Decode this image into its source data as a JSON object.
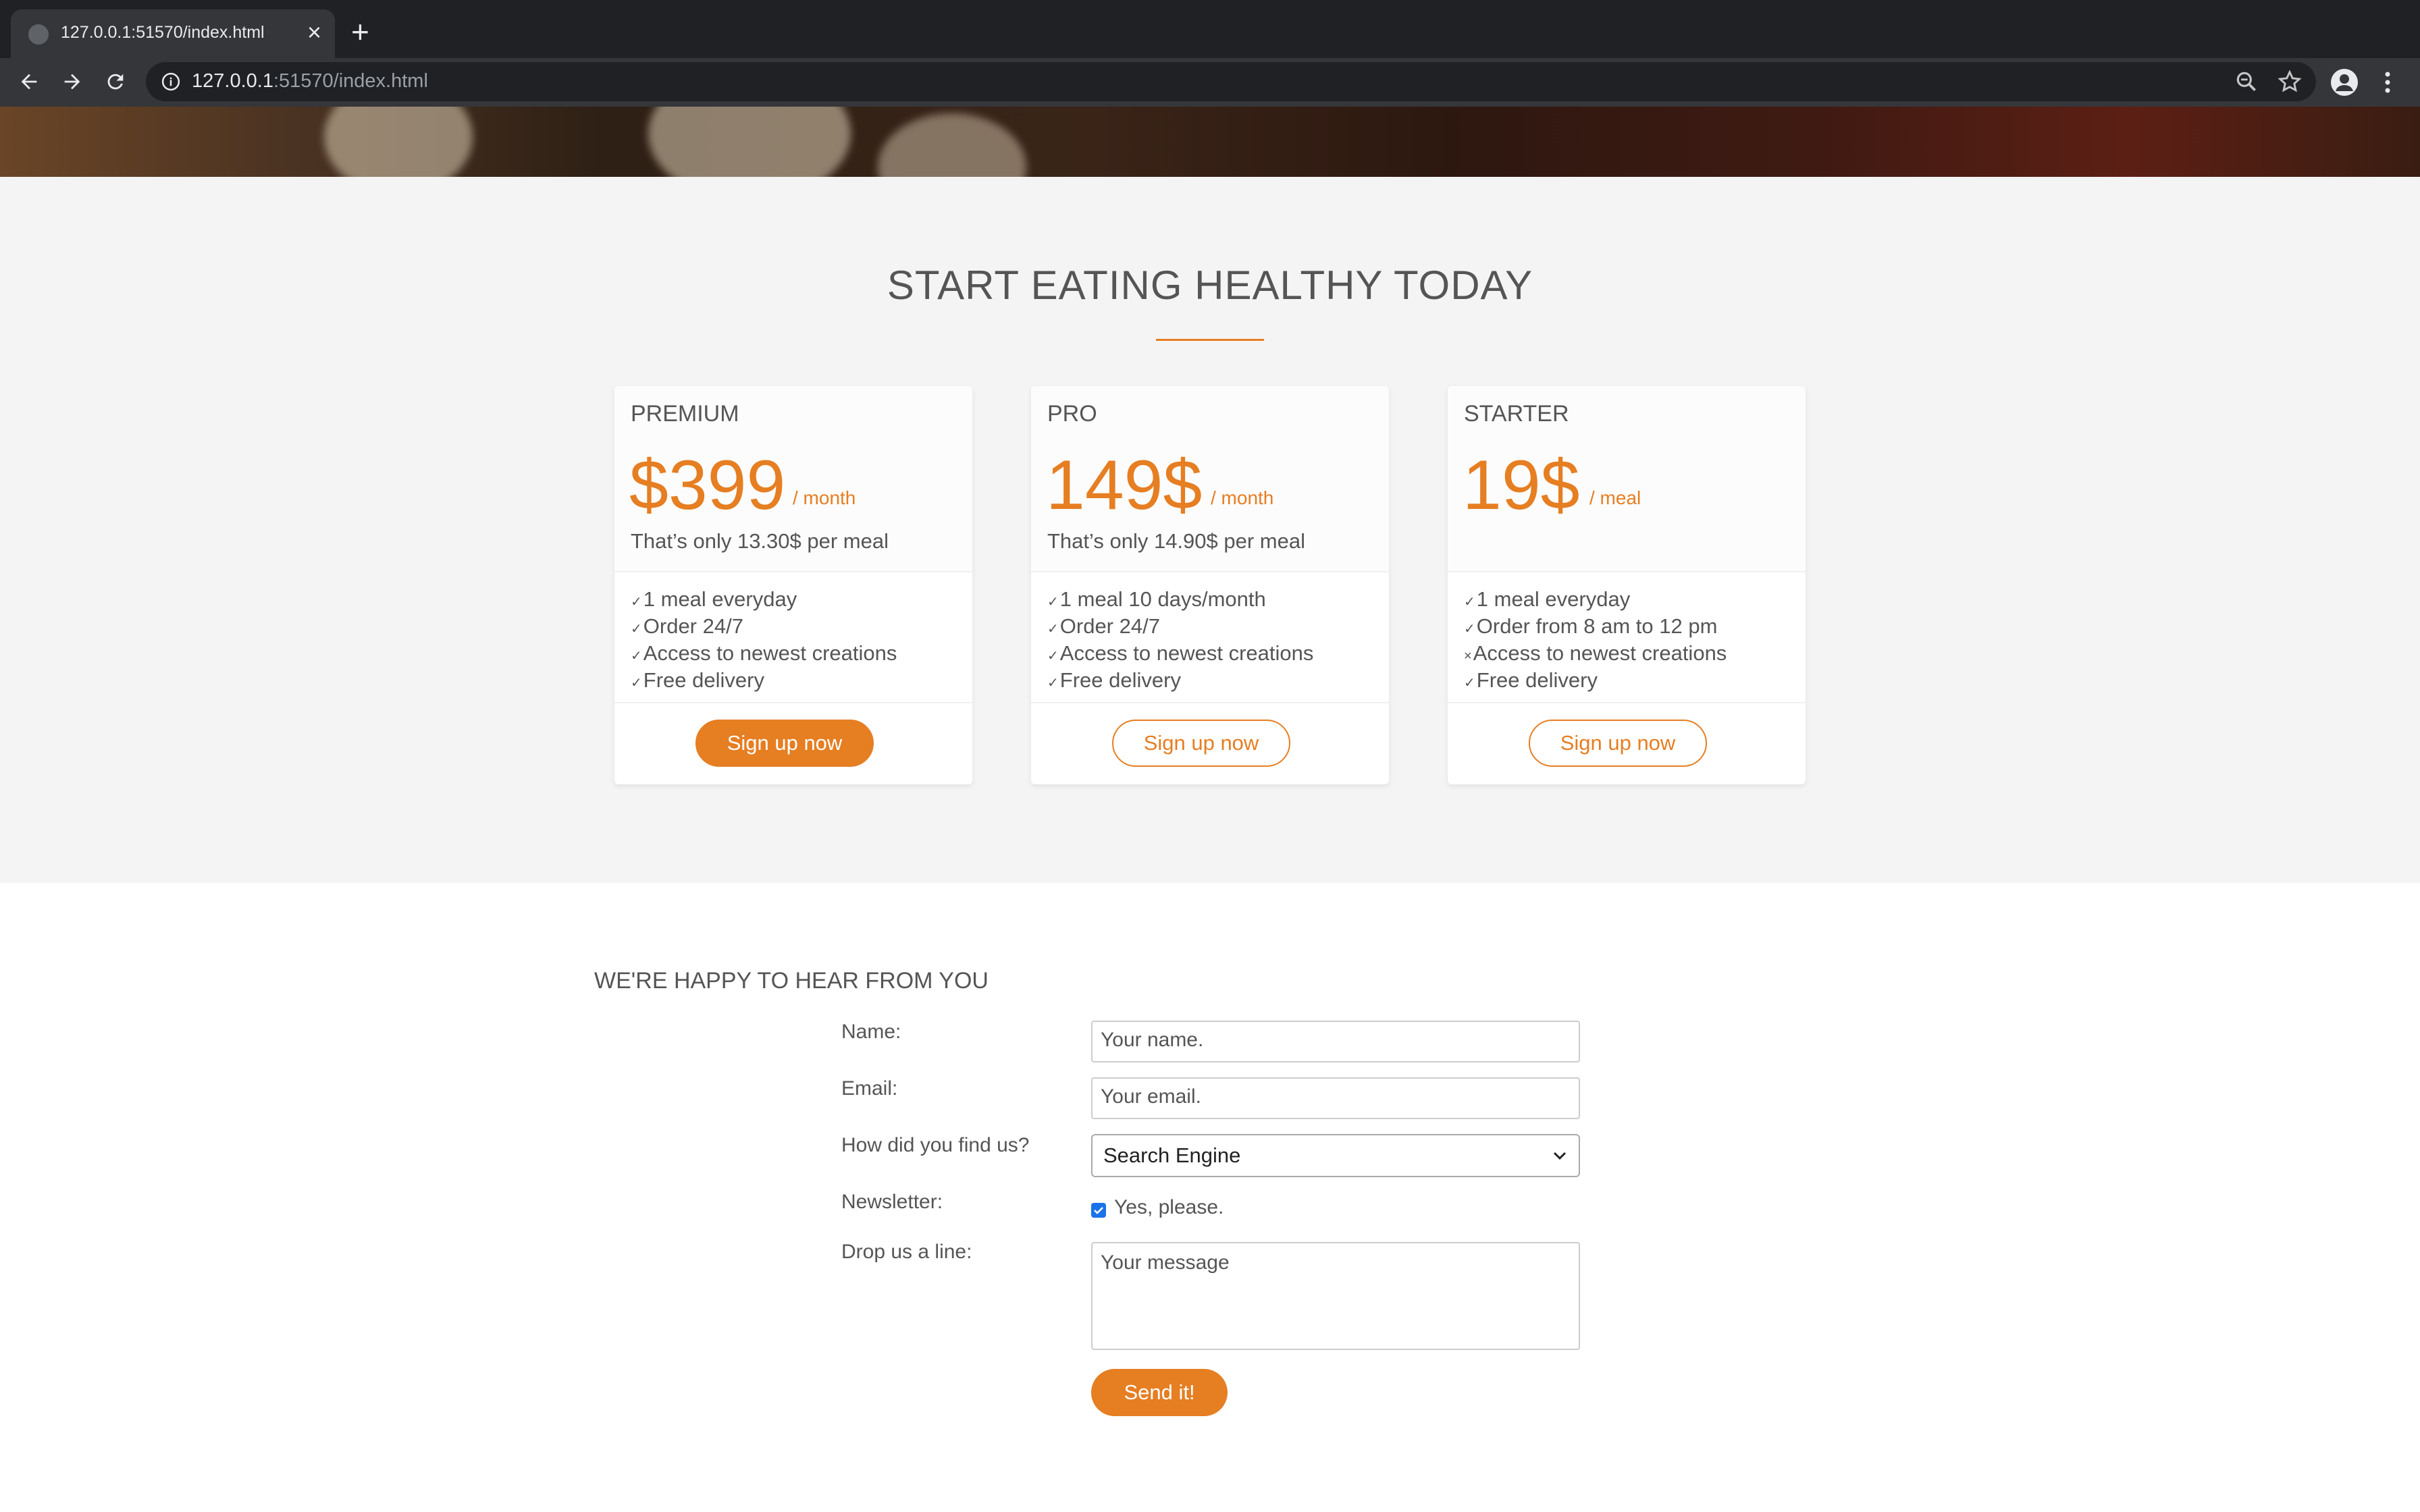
{
  "browser": {
    "tab_title": "127.0.0.1:51570/index.html",
    "url_host": "127.0.0.1",
    "url_rest": ":51570/index.html"
  },
  "pricing": {
    "title": "START EATING HEALTHY TODAY",
    "plans": [
      {
        "name": "PREMIUM",
        "price": "$399",
        "unit": "/ month",
        "note": "That’s only 13.30$ per meal",
        "features": [
          {
            "mark": "✓",
            "text": "1 meal everyday"
          },
          {
            "mark": "✓",
            "text": "Order 24/7"
          },
          {
            "mark": "✓",
            "text": "Access to newest creations"
          },
          {
            "mark": "✓",
            "text": "Free delivery"
          }
        ],
        "button": "Sign up now"
      },
      {
        "name": "PRO",
        "price": "149$",
        "unit": "/ month",
        "note": "That’s only 14.90$ per meal",
        "features": [
          {
            "mark": "✓",
            "text": "1 meal 10 days/month"
          },
          {
            "mark": "✓",
            "text": "Order 24/7"
          },
          {
            "mark": "✓",
            "text": "Access to newest creations"
          },
          {
            "mark": "✓",
            "text": "Free delivery"
          }
        ],
        "button": "Sign up now"
      },
      {
        "name": "STARTER",
        "price": "19$",
        "unit": "/ meal",
        "note": "",
        "features": [
          {
            "mark": "✓",
            "text": "1 meal everyday"
          },
          {
            "mark": "✓",
            "text": "Order from 8 am to 12 pm"
          },
          {
            "mark": "×",
            "text": "Access to newest creations"
          },
          {
            "mark": "✓",
            "text": "Free delivery"
          }
        ],
        "button": "Sign up now"
      }
    ]
  },
  "contact": {
    "title": "WE'RE HAPPY TO HEAR FROM YOU",
    "name_label": "Name:",
    "name_placeholder": "Your name.",
    "email_label": "Email:",
    "email_placeholder": "Your email.",
    "find_label": "How did you find us?",
    "find_selected": "Search Engine",
    "newsletter_label": "Newsletter:",
    "newsletter_option": "Yes, please.",
    "message_label": "Drop us a line:",
    "message_placeholder": "Your message",
    "send_button": "Send it!"
  },
  "colors": {
    "accent": "#e67e22",
    "section_bg": "#f4f4f4",
    "text": "#555555"
  }
}
